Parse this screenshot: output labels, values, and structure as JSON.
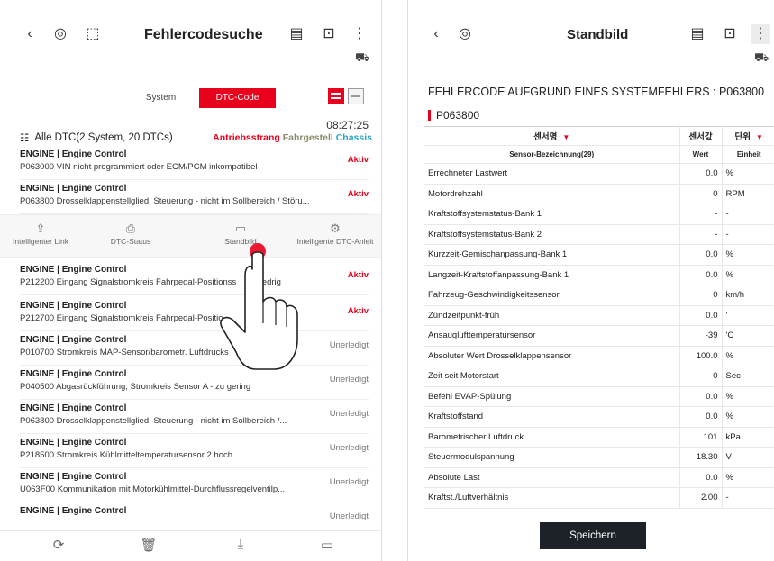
{
  "left": {
    "title": "Fehlercodesuche",
    "tabs": [
      "System",
      "DTC-Code"
    ],
    "time": "08:27:25",
    "all_dtc": "Alle DTC(2 System, 20 DTCs)",
    "filters": [
      "Antriebsstrang",
      "Fahrgestell",
      "Chassis"
    ],
    "dtcs_top": [
      {
        "head": "ENGINE | Engine Control",
        "desc": "P063000 VIN nicht programmiert oder ECM/PCM inkompatibel",
        "status": "Aktiv"
      },
      {
        "head": "ENGINE | Engine Control",
        "desc": "P063800 Drosselklappenstellglied, Steuerung - nicht im Sollbereich / Störu...",
        "status": "Aktiv"
      }
    ],
    "actions": [
      "Intelligenter Link",
      "DTC-Status",
      "Standbild",
      "Intelligente DTC-Anleit"
    ],
    "dtcs_bottom": [
      {
        "head": "ENGINE | Engine Control",
        "desc": "P212200 Eingang Signalstromkreis Fahrpedal-Positionss     1 niedrig",
        "status": "Aktiv"
      },
      {
        "head": "ENGINE | Engine Control",
        "desc": "P212700 Eingang Signalstromkreis Fahrpedal-Positio          ig",
        "status": "Aktiv"
      },
      {
        "head": "ENGINE | Engine Control",
        "desc": "P010700 Stromkreis MAP-Sensor/barometr. Luftdrucks      an...",
        "status": "Unerledigt"
      },
      {
        "head": "ENGINE | Engine Control",
        "desc": "P040500 Abgasrückführung, Stromkreis Sensor A - zu gering",
        "status": "Unerledigt"
      },
      {
        "head": "ENGINE | Engine Control",
        "desc": "P063800 Drosselklappenstellglied, Steuerung - nicht im Sollbereich /...",
        "status": "Unerledigt"
      },
      {
        "head": "ENGINE | Engine Control",
        "desc": "P218500 Stromkreis Kühlmitteltemperatursensor 2 hoch",
        "status": "Unerledigt"
      },
      {
        "head": "ENGINE | Engine Control",
        "desc": "U063F00 Kommunikation mit Motorkühlmittel-Durchflussregelventilp...",
        "status": "Unerledigt"
      },
      {
        "head": "ENGINE | Engine Control",
        "desc": "",
        "status": "Unerledigt"
      }
    ]
  },
  "right": {
    "title": "Standbild",
    "fc_title": "FEHLERCODE AUFGRUND EINES SYSTEMFEHLERS : P063800",
    "code": "P063800",
    "header_kr": [
      "센서명",
      "센서값",
      "단위"
    ],
    "header_de": [
      "Sensor-Bezeichnung(29)",
      "Wert",
      "Einheit"
    ],
    "rows": [
      [
        "Errechneter Lastwert",
        "0.0",
        "%"
      ],
      [
        "Motordrehzahl",
        "0",
        "RPM"
      ],
      [
        "Kraftstoffsystemstatus-Bank 1",
        "-",
        "-"
      ],
      [
        "Kraftstoffsystemstatus-Bank 2",
        "-",
        "-"
      ],
      [
        "Kurzzeit-Gemischanpassung-Bank 1",
        "0.0",
        "%"
      ],
      [
        "Langzeit-Kraftstoffanpassung-Bank 1",
        "0.0",
        "%"
      ],
      [
        "Fahrzeug-Geschwindigkeitssensor",
        "0",
        "km/h"
      ],
      [
        "Zündzeitpunkt-früh",
        "0.0",
        "'"
      ],
      [
        "Ansauglufttemperatursensor",
        "-39",
        "'C"
      ],
      [
        "Absoluter Wert Drosselklappensensor",
        "100.0",
        "%"
      ],
      [
        "Zeit seit Motorstart",
        "0",
        "Sec"
      ],
      [
        "Befehl EVAP-Spülung",
        "0.0",
        "%"
      ],
      [
        "Kraftstoffstand",
        "0.0",
        "%"
      ],
      [
        "Barometrischer Luftdruck",
        "101",
        "kPa"
      ],
      [
        "Steuermodulspannung",
        "18.30",
        "V"
      ],
      [
        "Absolute Last",
        "0.0",
        "%"
      ],
      [
        "Kraftst./Luftverhältnis",
        "2.00",
        "-"
      ]
    ],
    "save": "Speichern"
  },
  "colors": {
    "accent": "#e8001c",
    "chassis": "#2aa3c8",
    "button_dark": "#1d2228"
  }
}
